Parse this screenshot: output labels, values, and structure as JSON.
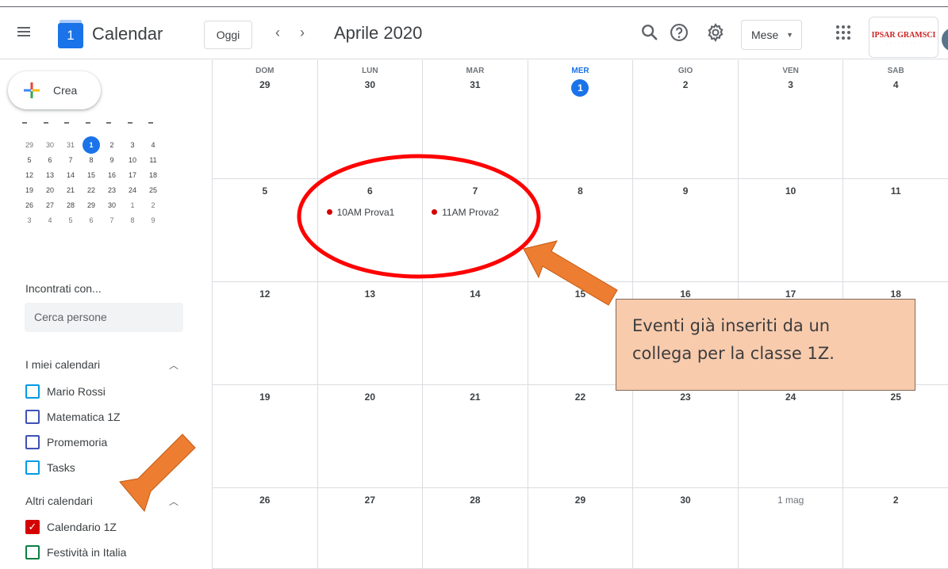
{
  "header": {
    "app_title": "Calendar",
    "logo_day": "1",
    "today_button": "Oggi",
    "prev_icon": "‹",
    "next_icon": "›",
    "period_title": "Aprile 2020",
    "view_select": "Mese",
    "org_logo_text": "IPSAR GRAMSCI",
    "icons": [
      "menu-icon",
      "search-icon",
      "help-icon",
      "settings-icon",
      "apps-grid-icon"
    ]
  },
  "sidebar": {
    "create_label": "Crea",
    "mini_calendar": {
      "weeks": [
        [
          {
            "d": "29",
            "o": true
          },
          {
            "d": "30",
            "o": true
          },
          {
            "d": "31",
            "o": true
          },
          {
            "d": "1",
            "t": true
          },
          {
            "d": "2"
          },
          {
            "d": "3"
          },
          {
            "d": "4"
          }
        ],
        [
          {
            "d": "5"
          },
          {
            "d": "6"
          },
          {
            "d": "7"
          },
          {
            "d": "8"
          },
          {
            "d": "9"
          },
          {
            "d": "10"
          },
          {
            "d": "11"
          }
        ],
        [
          {
            "d": "12"
          },
          {
            "d": "13"
          },
          {
            "d": "14"
          },
          {
            "d": "15"
          },
          {
            "d": "16"
          },
          {
            "d": "17"
          },
          {
            "d": "18"
          }
        ],
        [
          {
            "d": "19"
          },
          {
            "d": "20"
          },
          {
            "d": "21"
          },
          {
            "d": "22"
          },
          {
            "d": "23"
          },
          {
            "d": "24"
          },
          {
            "d": "25"
          }
        ],
        [
          {
            "d": "26"
          },
          {
            "d": "27"
          },
          {
            "d": "28"
          },
          {
            "d": "29"
          },
          {
            "d": "30"
          },
          {
            "d": "1",
            "o": true
          },
          {
            "d": "2",
            "o": true
          }
        ],
        [
          {
            "d": "3",
            "o": true
          },
          {
            "d": "4",
            "o": true
          },
          {
            "d": "5",
            "o": true
          },
          {
            "d": "6",
            "o": true
          },
          {
            "d": "7",
            "o": true
          },
          {
            "d": "8",
            "o": true
          },
          {
            "d": "9",
            "o": true
          }
        ]
      ]
    },
    "meet_title": "Incontrati con...",
    "people_search_placeholder": "Cerca persone",
    "my_calendars_title": "I miei calendari",
    "my_calendars": [
      {
        "label": "Mario Rossi",
        "color": "#039be5",
        "checked": false
      },
      {
        "label": "Matematica 1Z",
        "color": "#3f51b5",
        "checked": false
      },
      {
        "label": "Promemoria",
        "color": "#3f51b5",
        "checked": false
      },
      {
        "label": "Tasks",
        "color": "#039be5",
        "checked": false
      }
    ],
    "other_calendars_title": "Altri calendari",
    "other_calendars": [
      {
        "label": "Calendario 1Z",
        "color": "#d50000",
        "checked": true
      },
      {
        "label": "Festività in Italia",
        "color": "#0b8043",
        "checked": false
      }
    ]
  },
  "month": {
    "weekdays": [
      "DOM",
      "LUN",
      "MAR",
      "MER",
      "GIO",
      "VEN",
      "SAB"
    ],
    "today_column": 3,
    "weeks": [
      [
        "29",
        "30",
        "31",
        "1",
        "2",
        "3",
        "4"
      ],
      [
        "5",
        "6",
        "7",
        "8",
        "9",
        "10",
        "11"
      ],
      [
        "12",
        "13",
        "14",
        "15",
        "16",
        "17",
        "18"
      ],
      [
        "19",
        "20",
        "21",
        "22",
        "23",
        "24",
        "25"
      ],
      [
        "26",
        "27",
        "28",
        "29",
        "30",
        "1 mag",
        "2"
      ]
    ],
    "today_cell": {
      "week": 0,
      "col": 3
    },
    "events": [
      {
        "week": 1,
        "col": 1,
        "time": "10AM",
        "title": "Prova1",
        "color": "#d50000"
      },
      {
        "week": 1,
        "col": 2,
        "time": "11AM",
        "title": "Prova2",
        "color": "#d50000"
      }
    ]
  },
  "annotation": {
    "callout_line1": "Eventi già inseriti da un",
    "callout_line2": "collega per la classe 1Z.",
    "callout_color": "#f8cbad",
    "arrow_color": "#ed7d31",
    "ellipse_color": "#ff0000"
  }
}
